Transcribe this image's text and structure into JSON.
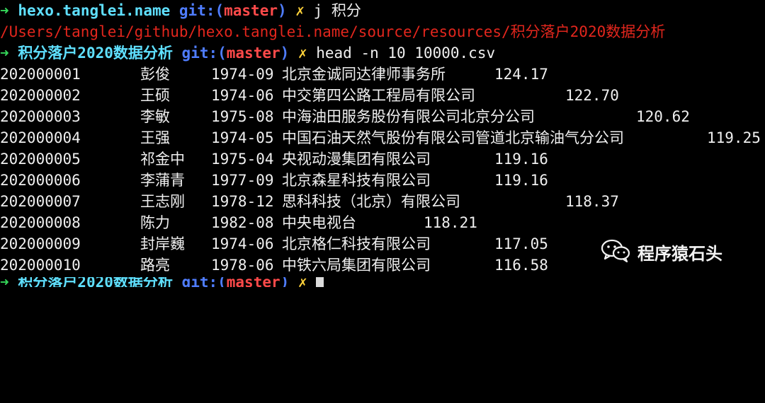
{
  "terminal": {
    "prompt1": {
      "arrow": "➜",
      "dir": "hexo.tanglei.name",
      "git_label": "git:(",
      "branch": "master",
      "git_close": ")",
      "dirty": "✗",
      "command": "j 积分"
    },
    "jump_output": "/Users/tanglei/github/hexo.tanglei.name/source/resources/积分落户2020数据分析",
    "prompt2": {
      "arrow": "➜",
      "dir": "积分落户2020数据分析",
      "git_label": "git:(",
      "branch": "master",
      "git_close": ")",
      "dirty": "✗",
      "command": "head -n 10 10000.csv"
    },
    "rows": [
      {
        "id": "202000001",
        "name": "彭俊",
        "date": "1974-09",
        "company": "北京金诚同达律师事务所",
        "score": "124.17"
      },
      {
        "id": "202000002",
        "name": "王硕",
        "date": "1974-06",
        "company": "中交第四公路工程局有限公司",
        "score": "122.70"
      },
      {
        "id": "202000003",
        "name": "李敏",
        "date": "1975-08",
        "company": "中海油田服务股份有限公司北京分公司",
        "score": "120.62"
      },
      {
        "id": "202000004",
        "name": "王强",
        "date": "1974-05",
        "company": "中国石油天然气股份有限公司管道北京输油气分公司",
        "score": "119.25"
      },
      {
        "id": "202000005",
        "name": "祁金中",
        "date": "1975-04",
        "company": "央视动漫集团有限公司",
        "score": "119.16"
      },
      {
        "id": "202000006",
        "name": "李蒲青",
        "date": "1977-09",
        "company": "北京森星科技有限公司",
        "score": "119.16"
      },
      {
        "id": "202000007",
        "name": "王志刚",
        "date": "1978-12",
        "company": "思科科技（北京）有限公司",
        "score": "118.37"
      },
      {
        "id": "202000008",
        "name": "陈力",
        "date": "1982-08",
        "company": "中央电视台",
        "score": "118.21"
      },
      {
        "id": "202000009",
        "name": "封岸巍",
        "date": "1974-06",
        "company": "北京格仁科技有限公司",
        "score": "117.05"
      },
      {
        "id": "202000010",
        "name": "路亮",
        "date": "1978-06",
        "company": "中铁六局集团有限公司",
        "score": "116.58"
      }
    ],
    "prompt3": {
      "arrow": "➜",
      "dir": "积分落户2020数据分析",
      "git_label": "git:(",
      "branch": "master",
      "git_close": ")",
      "dirty": "✗"
    }
  },
  "watermark": {
    "icon": "wechat-icon",
    "text": "程序猿石头"
  }
}
